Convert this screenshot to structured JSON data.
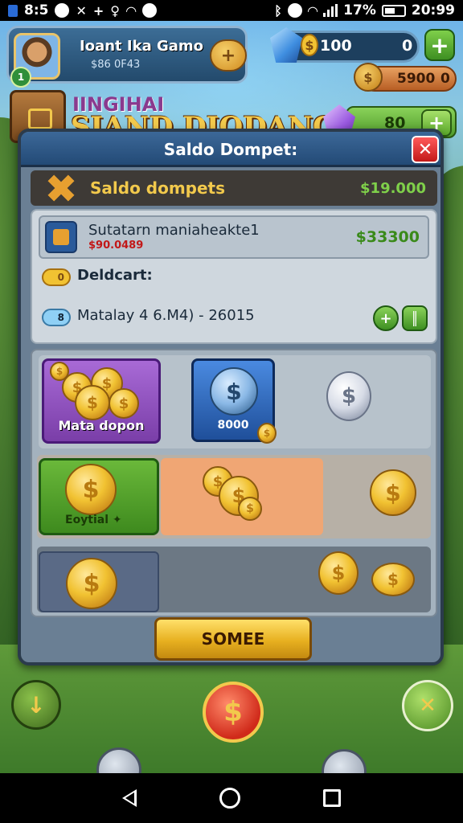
{
  "status_bar": {
    "left_time": "8:5",
    "right_battery": "17%",
    "right_time": "20:99"
  },
  "hud": {
    "player_name": "Ioant Ika Gamo",
    "player_id": "$86 0F43",
    "level": "1",
    "gem_value": "100",
    "gem_secondary": "0",
    "gold_value": "5900",
    "gold_secondary": "0",
    "purple_value": "80",
    "subtitle": "IINGIHAI",
    "title": "SIAND DIODANGA"
  },
  "dialog": {
    "title": "Saldo Dompet:",
    "wallet_label": "Saldo dompets",
    "wallet_amount": "$19.000",
    "row1_title": "Sutatarn maniaheakte1",
    "row1_sub": "$90.0489",
    "row1_amount": "$33300",
    "row2_badge": "0",
    "row2_label": "Deldcart:",
    "row3_badge": "8",
    "row3_label": "Matalay 4 6.M4) - 26015",
    "tile_purple_label": "Mata dopon",
    "tile_blue_label": "8000",
    "tile_green_label": "Eoytial ✦",
    "confirm_label": "SOMEE"
  },
  "icons": {
    "coin_symbol": "$",
    "plus_symbol": "+",
    "close_symbol": "✕",
    "arrow_symbol": "↓"
  },
  "colors": {
    "accent_gold": "#f2c94c",
    "accent_green": "#7fd04a",
    "dialog_blue": "#234a76"
  }
}
